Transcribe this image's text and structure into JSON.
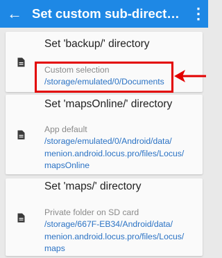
{
  "appbar": {
    "title": "Set custom sub-directories",
    "back_glyph": "←",
    "menu_glyph": "⋮"
  },
  "cards": [
    {
      "title": "Set 'backup/' directory",
      "subtitle": "Custom selection",
      "path": "/storage/emulated/0/Documents"
    },
    {
      "title": "Set 'mapsOnline/' directory",
      "subtitle": "App default",
      "path": "/storage/emulated/0/Android/data/\nmenion.android.locus.pro/files/Locus/\nmapsOnline"
    },
    {
      "title": "Set 'maps/' directory",
      "subtitle": "Private folder on SD card",
      "path": "/storage/667F-EB34/Android/data/\nmenion.android.locus.pro/files/Locus/\nmaps"
    }
  ],
  "colors": {
    "appbar": "#1e88e5",
    "link": "#2a72c4",
    "highlight": "#e30000"
  },
  "icons": [
    "back-arrow-icon",
    "overflow-menu-icon",
    "document-icon"
  ]
}
